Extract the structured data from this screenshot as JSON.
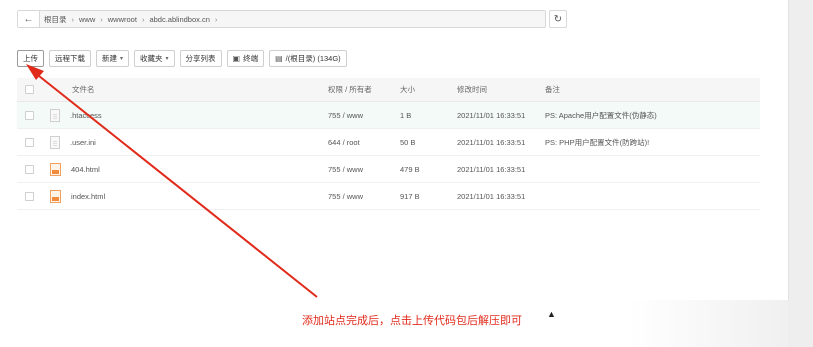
{
  "address_bar": {
    "back_icon": "arrow-left-icon",
    "crumbs": [
      "根目录",
      "www",
      "wwwroot",
      "abdc.ablindbox.cn"
    ],
    "refresh_icon": "refresh-icon"
  },
  "toolbar": {
    "upload": "上传",
    "remote_download": "远程下载",
    "new": "新建",
    "favorites": "收藏夹",
    "share_list": "分享列表",
    "terminal": "终端",
    "disk": "/(根目录) (134G)"
  },
  "table": {
    "headers": {
      "name": "文件名",
      "perm": "权限 / 所有者",
      "size": "大小",
      "mtime": "修改时间",
      "note": "备注"
    },
    "rows": [
      {
        "name": ".htaccess",
        "perm": "755 / www",
        "size": "1 B",
        "mtime": "2021/11/01 16:33:51",
        "note": "PS: Apache用户配置文件(伪静态)",
        "icon": "file-icon"
      },
      {
        "name": ".user.ini",
        "perm": "644 / root",
        "size": "50 B",
        "mtime": "2021/11/01 16:33:51",
        "note": "PS: PHP用户配置文件(防跨站)!",
        "icon": "file-icon"
      },
      {
        "name": "404.html",
        "perm": "755 / www",
        "size": "479 B",
        "mtime": "2021/11/01 16:33:51",
        "note": "",
        "icon": "html-file-icon"
      },
      {
        "name": "index.html",
        "perm": "755 / www",
        "size": "917 B",
        "mtime": "2021/11/01 16:33:51",
        "note": "",
        "icon": "html-file-icon"
      }
    ]
  },
  "annotation": {
    "text": "添加站点完成后，点击上传代码包后解压即可",
    "color": "#e02a1a"
  }
}
